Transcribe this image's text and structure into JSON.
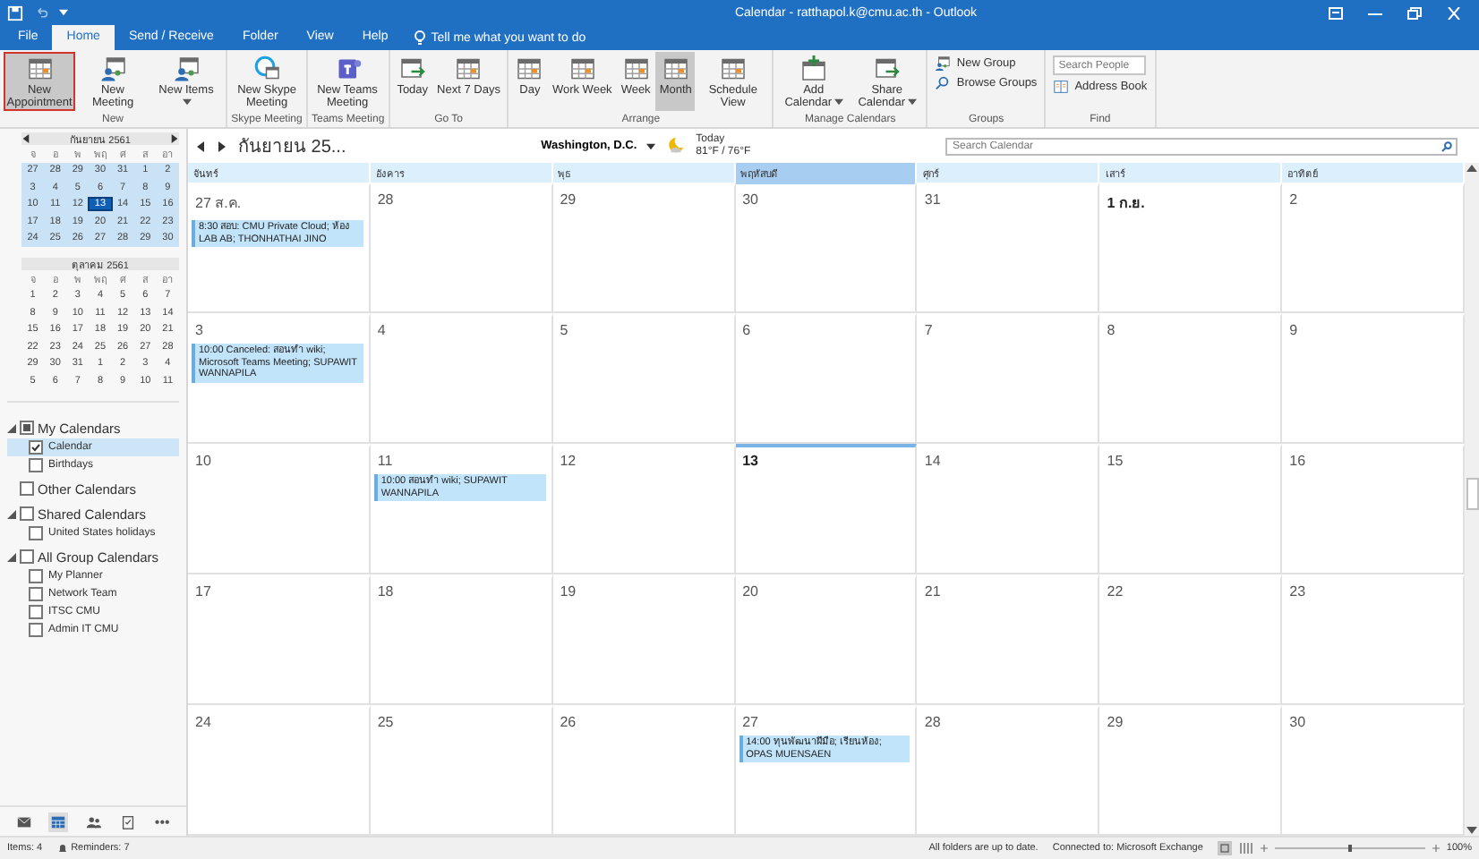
{
  "window": {
    "title": "Calendar - ratthapol.k@cmu.ac.th - Outlook"
  },
  "tabs": [
    {
      "label": "File",
      "selected": false
    },
    {
      "label": "Home",
      "selected": true
    },
    {
      "label": "Send / Receive",
      "selected": false
    },
    {
      "label": "Folder",
      "selected": false
    },
    {
      "label": "View",
      "selected": false
    },
    {
      "label": "Help",
      "selected": false
    }
  ],
  "tell_me": "Tell me what you want to do",
  "ribbon": {
    "groups": [
      {
        "label": "New",
        "buttons": [
          {
            "kind": "large",
            "label": "New Appointment",
            "selected": true,
            "outlined": true,
            "dropdown": false
          },
          {
            "kind": "large",
            "label": "New Meeting",
            "selected": false,
            "outlined": false,
            "dropdown": false
          },
          {
            "kind": "large",
            "label": "New Items",
            "selected": false,
            "outlined": false,
            "dropdown": true
          }
        ]
      },
      {
        "label": "Skype Meeting",
        "buttons": [
          {
            "kind": "large",
            "label": "New Skype Meeting",
            "selected": false,
            "outlined": false,
            "dropdown": false
          }
        ]
      },
      {
        "label": "Teams Meeting",
        "buttons": [
          {
            "kind": "large",
            "label": "New Teams Meeting",
            "selected": false,
            "outlined": false,
            "dropdown": false
          }
        ]
      },
      {
        "label": "Go To",
        "buttons": [
          {
            "kind": "large",
            "label": "Today",
            "selected": false,
            "outlined": false,
            "dropdown": false
          },
          {
            "kind": "large",
            "label": "Next 7 Days",
            "selected": false,
            "outlined": false,
            "dropdown": false
          }
        ]
      },
      {
        "label": "Arrange",
        "buttons": [
          {
            "kind": "large",
            "label": "Day",
            "selected": false,
            "outlined": false,
            "dropdown": false
          },
          {
            "kind": "large",
            "label": "Work Week",
            "selected": false,
            "outlined": false,
            "dropdown": false
          },
          {
            "kind": "large",
            "label": "Week",
            "selected": false,
            "outlined": false,
            "dropdown": false
          },
          {
            "kind": "large",
            "label": "Month",
            "selected": true,
            "outlined": false,
            "dropdown": false
          },
          {
            "kind": "large",
            "label": "Schedule View",
            "selected": false,
            "outlined": false,
            "dropdown": false
          }
        ]
      },
      {
        "label": "Manage Calendars",
        "buttons": [
          {
            "kind": "large",
            "label": "Add Calendar",
            "selected": false,
            "outlined": false,
            "dropdown": true
          },
          {
            "kind": "large",
            "label": "Share Calendar",
            "selected": false,
            "outlined": false,
            "dropdown": true
          }
        ]
      },
      {
        "label": "Groups",
        "buttons": [
          {
            "kind": "small",
            "label": "New Group",
            "selected": false,
            "outlined": false,
            "dropdown": false
          },
          {
            "kind": "small",
            "label": "Browse Groups",
            "selected": false,
            "outlined": false,
            "dropdown": false
          }
        ]
      },
      {
        "label": "Find",
        "buttons": [
          {
            "kind": "field",
            "placeholder": "Search People"
          },
          {
            "kind": "small",
            "label": "Address Book",
            "selected": false,
            "outlined": false,
            "dropdown": false
          }
        ]
      }
    ]
  },
  "mini_calendars": [
    {
      "title": "กันยายน 2561",
      "arrows": true,
      "weekdays": [
        "จ",
        "อ",
        "พ",
        "พฤ",
        "ศ",
        "ส",
        "อา"
      ],
      "weeks": [
        {
          "selected": true,
          "days": [
            {
              "label": "27",
              "today": false
            },
            {
              "label": "28",
              "today": false
            },
            {
              "label": "29",
              "today": false
            },
            {
              "label": "30",
              "today": false
            },
            {
              "label": "31",
              "today": false
            },
            {
              "label": "1",
              "today": false
            },
            {
              "label": "2",
              "today": false
            }
          ]
        },
        {
          "selected": true,
          "days": [
            {
              "label": "3",
              "today": false
            },
            {
              "label": "4",
              "today": false
            },
            {
              "label": "5",
              "today": false
            },
            {
              "label": "6",
              "today": false
            },
            {
              "label": "7",
              "today": false
            },
            {
              "label": "8",
              "today": false
            },
            {
              "label": "9",
              "today": false
            }
          ]
        },
        {
          "selected": true,
          "days": [
            {
              "label": "10",
              "today": false
            },
            {
              "label": "11",
              "today": false
            },
            {
              "label": "12",
              "today": false
            },
            {
              "label": "13",
              "today": true
            },
            {
              "label": "14",
              "today": false
            },
            {
              "label": "15",
              "today": false
            },
            {
              "label": "16",
              "today": false
            }
          ]
        },
        {
          "selected": true,
          "days": [
            {
              "label": "17",
              "today": false
            },
            {
              "label": "18",
              "today": false
            },
            {
              "label": "19",
              "today": false
            },
            {
              "label": "20",
              "today": false
            },
            {
              "label": "21",
              "today": false
            },
            {
              "label": "22",
              "today": false
            },
            {
              "label": "23",
              "today": false
            }
          ]
        },
        {
          "selected": true,
          "days": [
            {
              "label": "24",
              "today": false
            },
            {
              "label": "25",
              "today": false
            },
            {
              "label": "26",
              "today": false
            },
            {
              "label": "27",
              "today": false
            },
            {
              "label": "28",
              "today": false
            },
            {
              "label": "29",
              "today": false
            },
            {
              "label": "30",
              "today": false
            }
          ]
        }
      ]
    },
    {
      "title": "ตุลาคม 2561",
      "arrows": false,
      "weekdays": [
        "จ",
        "อ",
        "พ",
        "พฤ",
        "ศ",
        "ส",
        "อา"
      ],
      "weeks": [
        {
          "selected": false,
          "days": [
            {
              "label": "1",
              "today": false
            },
            {
              "label": "2",
              "today": false
            },
            {
              "label": "3",
              "today": false
            },
            {
              "label": "4",
              "today": false
            },
            {
              "label": "5",
              "today": false
            },
            {
              "label": "6",
              "today": false
            },
            {
              "label": "7",
              "today": false
            }
          ]
        },
        {
          "selected": false,
          "days": [
            {
              "label": "8",
              "today": false
            },
            {
              "label": "9",
              "today": false
            },
            {
              "label": "10",
              "today": false
            },
            {
              "label": "11",
              "today": false
            },
            {
              "label": "12",
              "today": false
            },
            {
              "label": "13",
              "today": false
            },
            {
              "label": "14",
              "today": false
            }
          ]
        },
        {
          "selected": false,
          "days": [
            {
              "label": "15",
              "today": false
            },
            {
              "label": "16",
              "today": false
            },
            {
              "label": "17",
              "today": false
            },
            {
              "label": "18",
              "today": false
            },
            {
              "label": "19",
              "today": false
            },
            {
              "label": "20",
              "today": false
            },
            {
              "label": "21",
              "today": false
            }
          ]
        },
        {
          "selected": false,
          "days": [
            {
              "label": "22",
              "today": false
            },
            {
              "label": "23",
              "today": false
            },
            {
              "label": "24",
              "today": false
            },
            {
              "label": "25",
              "today": false
            },
            {
              "label": "26",
              "today": false
            },
            {
              "label": "27",
              "today": false
            },
            {
              "label": "28",
              "today": false
            }
          ]
        },
        {
          "selected": false,
          "days": [
            {
              "label": "29",
              "today": false
            },
            {
              "label": "30",
              "today": false
            },
            {
              "label": "31",
              "today": false
            },
            {
              "label": "1",
              "today": false
            },
            {
              "label": "2",
              "today": false
            },
            {
              "label": "3",
              "today": false
            },
            {
              "label": "4",
              "today": false
            }
          ]
        },
        {
          "selected": false,
          "days": [
            {
              "label": "5",
              "today": false
            },
            {
              "label": "6",
              "today": false
            },
            {
              "label": "7",
              "today": false
            },
            {
              "label": "8",
              "today": false
            },
            {
              "label": "9",
              "today": false
            },
            {
              "label": "10",
              "today": false
            },
            {
              "label": "11",
              "today": false
            }
          ]
        }
      ]
    }
  ],
  "calendar_list": [
    {
      "name": "My Calendars",
      "checked": false,
      "partial": true,
      "items": [
        {
          "name": "Calendar",
          "checked": true,
          "selected": true
        },
        {
          "name": "Birthdays",
          "checked": false,
          "selected": false
        }
      ]
    },
    {
      "name": "Other Calendars",
      "checked": false,
      "partial": false
    },
    {
      "name": "Shared Calendars",
      "checked": false,
      "partial": false,
      "items": [
        {
          "name": "United States holidays",
          "checked": false,
          "selected": false
        }
      ]
    },
    {
      "name": "All Group Calendars",
      "checked": false,
      "partial": false,
      "items": [
        {
          "name": "My Planner",
          "checked": false,
          "selected": false
        },
        {
          "name": "Network Team",
          "checked": false,
          "selected": false
        },
        {
          "name": "ITSC CMU",
          "checked": false,
          "selected": false
        },
        {
          "name": "Admin IT CMU",
          "checked": false,
          "selected": false
        }
      ]
    }
  ],
  "nav_bar": [
    {
      "kind": "mail",
      "selected": false
    },
    {
      "kind": "calendar",
      "selected": true
    },
    {
      "kind": "people",
      "selected": false
    },
    {
      "kind": "tasks",
      "selected": false
    },
    {
      "kind": "more",
      "selected": false,
      "label": "•••"
    }
  ],
  "header": {
    "title": "กันยายน 25...",
    "location": "Washington, D.C.",
    "weather_label": "Today",
    "temperature": "81°F / 76°F",
    "search": {
      "placeholder": "Search Calendar"
    }
  },
  "weekdays": [
    {
      "label": "จันทร์",
      "selected": false
    },
    {
      "label": "อังคาร",
      "selected": false
    },
    {
      "label": "พุธ",
      "selected": false
    },
    {
      "label": "พฤหัสบดี",
      "selected": true
    },
    {
      "label": "ศุกร์",
      "selected": false
    },
    {
      "label": "เสาร์",
      "selected": false
    },
    {
      "label": "อาทิตย์",
      "selected": false
    }
  ],
  "weeks": [
    {
      "days": [
        {
          "label": "27 ส.ค.",
          "bold": false,
          "today": false,
          "events": [
            "8:30 สอบ: CMU Private Cloud; ห้อง LAB AB; THONHATHAI JINO"
          ]
        },
        {
          "label": "28",
          "bold": false,
          "today": false
        },
        {
          "label": "29",
          "bold": false,
          "today": false
        },
        {
          "label": "30",
          "bold": false,
          "today": false
        },
        {
          "label": "31",
          "bold": false,
          "today": false
        },
        {
          "label": "1 ก.ย.",
          "bold": true,
          "today": false
        },
        {
          "label": "2",
          "bold": false,
          "today": false
        }
      ]
    },
    {
      "days": [
        {
          "label": "3",
          "bold": false,
          "today": false,
          "events": [
            "10:00 Canceled: สอนทำ wiki; Microsoft Teams Meeting; SUPAWIT WANNAPILA"
          ]
        },
        {
          "label": "4",
          "bold": false,
          "today": false
        },
        {
          "label": "5",
          "bold": false,
          "today": false
        },
        {
          "label": "6",
          "bold": false,
          "today": false
        },
        {
          "label": "7",
          "bold": false,
          "today": false
        },
        {
          "label": "8",
          "bold": false,
          "today": false
        },
        {
          "label": "9",
          "bold": false,
          "today": false
        }
      ]
    },
    {
      "days": [
        {
          "label": "10",
          "bold": false,
          "today": false
        },
        {
          "label": "11",
          "bold": false,
          "today": false,
          "events": [
            "10:00 สอนทำ wiki; SUPAWIT WANNAPILA"
          ]
        },
        {
          "label": "12",
          "bold": false,
          "today": false
        },
        {
          "label": "13",
          "bold": true,
          "today": true
        },
        {
          "label": "14",
          "bold": false,
          "today": false
        },
        {
          "label": "15",
          "bold": false,
          "today": false
        },
        {
          "label": "16",
          "bold": false,
          "today": false
        }
      ]
    },
    {
      "days": [
        {
          "label": "17",
          "bold": false,
          "today": false
        },
        {
          "label": "18",
          "bold": false,
          "today": false
        },
        {
          "label": "19",
          "bold": false,
          "today": false
        },
        {
          "label": "20",
          "bold": false,
          "today": false
        },
        {
          "label": "21",
          "bold": false,
          "today": false
        },
        {
          "label": "22",
          "bold": false,
          "today": false
        },
        {
          "label": "23",
          "bold": false,
          "today": false
        }
      ]
    },
    {
      "days": [
        {
          "label": "24",
          "bold": false,
          "today": false
        },
        {
          "label": "25",
          "bold": false,
          "today": false
        },
        {
          "label": "26",
          "bold": false,
          "today": false
        },
        {
          "label": "27",
          "bold": false,
          "today": false,
          "events": [
            "14:00 ทุนพัฒนาฝีมือ; เรียนห้อง; OPAS MUENSAEN"
          ]
        },
        {
          "label": "28",
          "bold": false,
          "today": false
        },
        {
          "label": "29",
          "bold": false,
          "today": false
        },
        {
          "label": "30",
          "bold": false,
          "today": false
        }
      ]
    }
  ],
  "status_bar": {
    "items": "Items: 4",
    "reminders": "Reminders: 7",
    "sync": "All folders are up to date.",
    "connection": "Connected to: Microsoft Exchange",
    "zoom_slider": {
      "level": 0.5
    },
    "zoom": "100%"
  }
}
